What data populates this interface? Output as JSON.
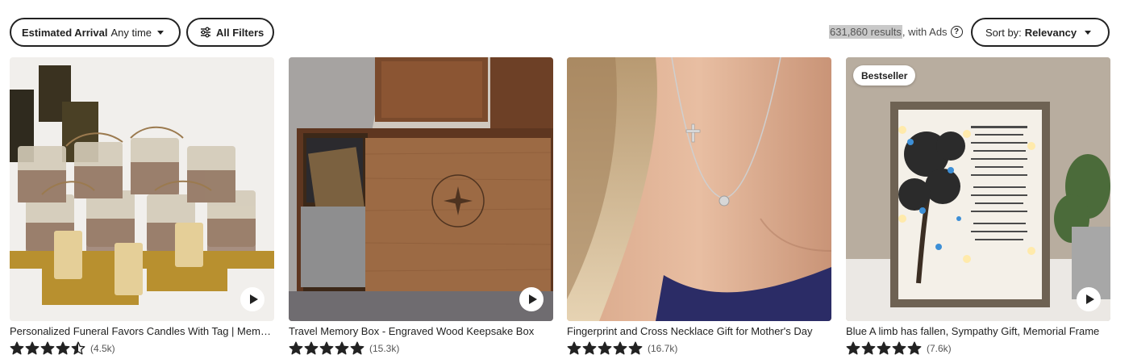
{
  "filters": {
    "arrival_label": "Estimated Arrival",
    "arrival_value": "Any time",
    "all_filters_label": "All Filters",
    "results_count": "631,860 results",
    "results_suffix": ", with Ads",
    "help_glyph": "?",
    "sort_label": "Sort by:",
    "sort_value": "Relevancy"
  },
  "listings": [
    {
      "title": "Personalized Funeral Favors Candles With Tag | Memorial Favor",
      "rating": 4.5,
      "reviews": "(4.5k)",
      "badge": "",
      "has_video": true
    },
    {
      "title": "Travel Memory Box - Engraved Wood Keepsake Box",
      "rating": 5,
      "reviews": "(15.3k)",
      "badge": "",
      "has_video": true
    },
    {
      "title": "Fingerprint and Cross Necklace Gift for Mother's Day",
      "rating": 5,
      "reviews": "(16.7k)",
      "badge": "",
      "has_video": false
    },
    {
      "title": "Blue A limb has fallen, Sympathy Gift, Memorial Frame",
      "rating": 5,
      "reviews": "(7.6k)",
      "badge": "Bestseller",
      "has_video": true
    }
  ],
  "icons": {
    "filters": "sliders-icon",
    "play": "play-icon",
    "star": "star-icon"
  }
}
